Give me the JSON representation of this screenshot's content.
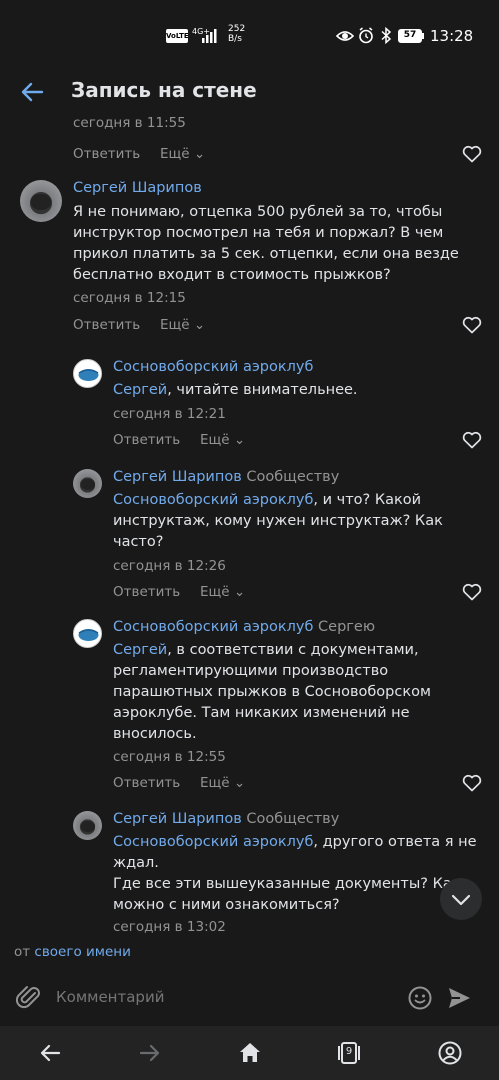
{
  "status_bar": {
    "network": "VoLTE",
    "signal": "4G+",
    "speed_value": "252",
    "speed_unit": "B/s",
    "battery": "57",
    "time": "13:28"
  },
  "header": {
    "title": "Запись на стене"
  },
  "top_partial": {
    "time": "сегодня в 11:55",
    "reply": "Ответить",
    "more": "Ещё"
  },
  "comments": [
    {
      "author": "Сергей Шарипов",
      "to": "",
      "mention": "",
      "text": "Я не понимаю, отцепка 500 рублей за то, чтобы инструктор посмотрел на тебя и поржал? В чем прикол платить за 5 сек. отцепки, если она везде бесплатно входит в стоимость прыжков?",
      "time": "сегодня в 12:15",
      "reply": "Ответить",
      "more": "Ещё"
    },
    {
      "author": "Сосновоборский аэроклуб",
      "to": "",
      "mention": "Сергей",
      "text": ", читайте внимательнее.",
      "time": "сегодня в 12:21",
      "reply": "Ответить",
      "more": "Ещё"
    },
    {
      "author": "Сергей Шарипов",
      "to": "Сообществу",
      "mention": "Сосновоборский аэроклуб",
      "text": ", и что? Какой инструктаж, кому нужен инструктаж? Как часто?",
      "time": "сегодня в 12:26",
      "reply": "Ответить",
      "more": "Ещё"
    },
    {
      "author": "Сосновоборский аэроклуб",
      "to": "Сергею",
      "mention": "Сергей",
      "text": ", в соответствии с документами, регламентирующими производство парашютных прыжков в Сосновоборском аэроклубе. Там никаких изменений не вносилось.",
      "time": "сегодня в 12:55",
      "reply": "Ответить",
      "more": "Ещё"
    },
    {
      "author": "Сергей Шарипов",
      "to": "Сообществу",
      "mention": "Сосновоборский аэроклуб",
      "text": ", другого ответа я не ждал.",
      "text2": "Где все эти вышеуказанные документы? Как можно с ними ознакомиться?",
      "time": "сегодня в 13:02"
    }
  ],
  "from": {
    "prefix": "от",
    "link": "своего имени"
  },
  "input": {
    "placeholder": "Комментарий"
  },
  "nav": {
    "tabs_count": "9"
  }
}
